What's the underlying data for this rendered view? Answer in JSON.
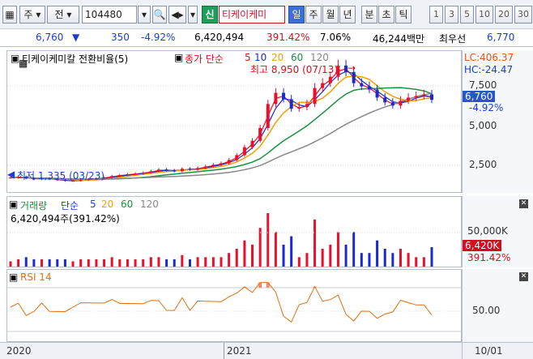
{
  "toolbar": {
    "period_main": "주",
    "label_jeon": "전",
    "code": "104480",
    "badge_sin": "신",
    "stock_name": "티케이케미",
    "periods": [
      "일",
      "주",
      "월",
      "년",
      "분",
      "초",
      "틱"
    ],
    "active_period": "일",
    "numbers": [
      "1",
      "3",
      "5",
      "10",
      "20",
      "30"
    ]
  },
  "infobar": {
    "price": "6,760",
    "change": "350",
    "change_pct": "-4.92%",
    "volume": "6,420,494",
    "volume_pct": "391.42%",
    "turnover": "7.06%",
    "amount": "46,244백만",
    "prior_label": "최우선",
    "prior_value": "6,770"
  },
  "price_panel": {
    "title": "티케이케미칼 전환비율(5)",
    "ma_label": "종가 단순",
    "ma_periods": [
      "5",
      "10",
      "20",
      "60",
      "120"
    ],
    "ma_colors": [
      "#e8102a",
      "#1a2ad0",
      "#f0a000",
      "#1a9040",
      "#888888"
    ],
    "high_label": "최고 8,950 (07/13)",
    "low_label": "최저 1,335 (03/23)",
    "lc": "LC:406.37",
    "hc": "HC:-24.47",
    "ticks": [
      "7,500",
      "5,000",
      "2,500"
    ],
    "cur_price": "6,760",
    "cur_pct": "-4.92%"
  },
  "volume_panel": {
    "title": "거래량",
    "ma_label": "단순",
    "ma_periods": [
      "5",
      "20",
      "60",
      "120"
    ],
    "value": "6,420,494주(391.42%)",
    "tick": "50,000K",
    "cur": "6,420K",
    "cur_pct": "391.42%"
  },
  "rsi_panel": {
    "title": "RSI 14",
    "tick": "50.00"
  },
  "time_axis": {
    "labels": [
      "2020",
      "2021"
    ],
    "date": "10/01"
  },
  "chart_data": [
    {
      "type": "candlestick",
      "title": "티케이케미칼 전환비율(5)",
      "x": [
        "2020",
        "2021",
        "10/01"
      ],
      "price_scale": [
        2500,
        5000,
        7500
      ],
      "high": 8950,
      "high_date": "07/13",
      "low": 1335,
      "low_date": "03/23",
      "close": 6760,
      "change_pct": -4.92,
      "series_close_approx": [
        1900,
        1950,
        1850,
        1800,
        1850,
        1800,
        1750,
        1700,
        1700,
        1750,
        1800,
        1850,
        1900,
        2000,
        2050,
        2100,
        2150,
        2200,
        2300,
        2400,
        2350,
        2300,
        2450,
        2400,
        2500,
        2600,
        2700,
        2800,
        3000,
        3300,
        3800,
        4200,
        5000,
        6500,
        7200,
        6800,
        6200,
        6300,
        6500,
        7500,
        7800,
        8200,
        8900,
        8500,
        7800,
        7600,
        7400,
        6900,
        6600,
        6400,
        6700,
        6900,
        7000,
        7100,
        6760
      ]
    },
    {
      "type": "bar",
      "title": "거래량",
      "value": 6420494,
      "unit": "주",
      "pct": 391.42,
      "ticks": [
        "50,000K"
      ]
    },
    {
      "type": "line",
      "title": "RSI 14",
      "ticks": [
        "50.00"
      ]
    }
  ]
}
